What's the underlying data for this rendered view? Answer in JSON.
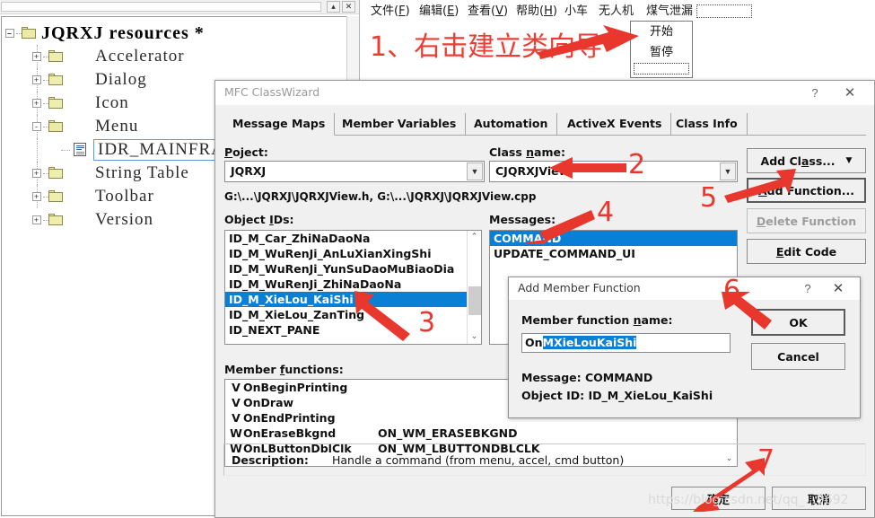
{
  "resource_tree": {
    "root": {
      "label": "JQRXJ resources *",
      "icon": "folder-open-icon"
    },
    "nodes": [
      {
        "label": "Accelerator",
        "icon": "folder-icon",
        "expander": "+"
      },
      {
        "label": "Dialog",
        "icon": "folder-icon",
        "expander": "+"
      },
      {
        "label": "Icon",
        "icon": "folder-icon",
        "expander": "+"
      },
      {
        "label": "Menu",
        "icon": "folder-open-icon",
        "expander": "-"
      },
      {
        "label": "String Table",
        "icon": "folder-icon",
        "expander": "+"
      },
      {
        "label": "Toolbar",
        "icon": "folder-icon",
        "expander": "+"
      },
      {
        "label": "Version",
        "icon": "folder-icon",
        "expander": "+"
      }
    ],
    "selected_child": {
      "label": "IDR_MAINFRAME",
      "icon": "menu-resource-icon"
    },
    "window_buttons": {
      "minimize": "▴",
      "close": "✕"
    }
  },
  "app_window": {
    "menubar": [
      {
        "text": "文件(",
        "mnemonic": "F",
        "close": ")"
      },
      {
        "text": "编辑(",
        "mnemonic": "E",
        "close": ")"
      },
      {
        "text": "查看(",
        "mnemonic": "V",
        "close": ")"
      },
      {
        "text": "帮助(",
        "mnemonic": "H",
        "close": ")"
      },
      {
        "text": "小车",
        "mnemonic": "",
        "close": ""
      },
      {
        "text": "无人机",
        "mnemonic": "",
        "close": ""
      },
      {
        "text": "煤气泄漏",
        "mnemonic": "",
        "close": ""
      }
    ],
    "annotation_1": "1、右击建立类向导",
    "popup_menu": {
      "items": [
        "开始",
        "暂停"
      ]
    }
  },
  "classwizard": {
    "title": "MFC ClassWizard",
    "help_glyph": "?",
    "close_glyph": "✕",
    "tabs": [
      {
        "label": "Message Maps",
        "active": true
      },
      {
        "label": "Member Variables",
        "active": false
      },
      {
        "label": "Automation",
        "active": false
      },
      {
        "label": "ActiveX Events",
        "active": false
      },
      {
        "label": "Class Info",
        "active": false
      }
    ],
    "project_label_pre": "P",
    "project_label_mn": "r",
    "project_label_post": "oject:",
    "project_value": "JQRXJ",
    "class_label_pre": "Class ",
    "class_label_mn": "n",
    "class_label_post": "ame:",
    "class_value": "CJQRXJView",
    "file_paths": "G:\\...\\JQRXJ\\JQRXJView.h, G:\\...\\JQRXJ\\JQRXJView.cpp",
    "object_ids_label_pre": "Object ",
    "object_ids_label_mn": "I",
    "object_ids_label_post": "Ds:",
    "object_ids": [
      {
        "id": "ID_M_Car_ZhiNaDaoNa",
        "selected": false
      },
      {
        "id": "ID_M_WuRenJi_AnLuXianXingShi",
        "selected": false
      },
      {
        "id": "ID_M_WuRenJi_YunSuDaoMuBiaoDia",
        "selected": false
      },
      {
        "id": "ID_M_WuRenJi_ZhiNaDaoNa",
        "selected": false
      },
      {
        "id": "ID_M_XieLou_KaiShi",
        "selected": true
      },
      {
        "id": "ID_M_XieLou_ZanTing",
        "selected": false
      },
      {
        "id": "ID_NEXT_PANE",
        "selected": false
      }
    ],
    "messages_label": "Messages:",
    "messages": [
      {
        "name": "COMMAND",
        "selected": true
      },
      {
        "name": "UPDATE_COMMAND_UI",
        "selected": false
      }
    ],
    "member_functions_label_pre": "Member ",
    "member_functions_label_mn": "f",
    "member_functions_label_post": "unctions:",
    "member_functions": [
      {
        "kind": "V",
        "name": "OnBeginPrinting",
        "message": ""
      },
      {
        "kind": "V",
        "name": "OnDraw",
        "message": ""
      },
      {
        "kind": "V",
        "name": "OnEndPrinting",
        "message": ""
      },
      {
        "kind": "W",
        "name": "OnEraseBkgnd",
        "message": "ON_WM_ERASEBKGND"
      },
      {
        "kind": "W",
        "name": "OnLButtonDblClk",
        "message": "ON_WM_LBUTTONDBLCLK"
      }
    ],
    "buttons": {
      "add_class": "Add Cl",
      "add_class_mn": "a",
      "add_class_post": "ss...",
      "add_class_arrow": "▼",
      "add_function_mn": "A",
      "add_function_post": "dd Function...",
      "delete_function_mn": "D",
      "delete_function_post": "elete Function",
      "edit_code_mn": "E",
      "edit_code_post": "dit Code",
      "ok": "确定",
      "cancel": "取消"
    },
    "description_label": "Description:",
    "description_text": "Handle a command (from menu, accel, cmd button)",
    "scroll_up": "⌃",
    "scroll_down": "⌄"
  },
  "add_member_function": {
    "title": "Add Member Function",
    "help_glyph": "?",
    "close_glyph": "✕",
    "name_label_pre": "Member function ",
    "name_label_mn": "n",
    "name_label_post": "ame:",
    "value_prefix": "On",
    "value_selected": "MXieLouKaiShi",
    "message_line": "Message: COMMAND",
    "object_id_line": "Object ID: ID_M_XieLou_KaiShi",
    "ok": "OK",
    "cancel": "Cancel"
  },
  "annotations": {
    "numbers": [
      "2",
      "3",
      "4",
      "5",
      "6",
      "7"
    ],
    "color": "#e8372c"
  },
  "watermark": "https://blog.csdn.net/qq_...9692"
}
